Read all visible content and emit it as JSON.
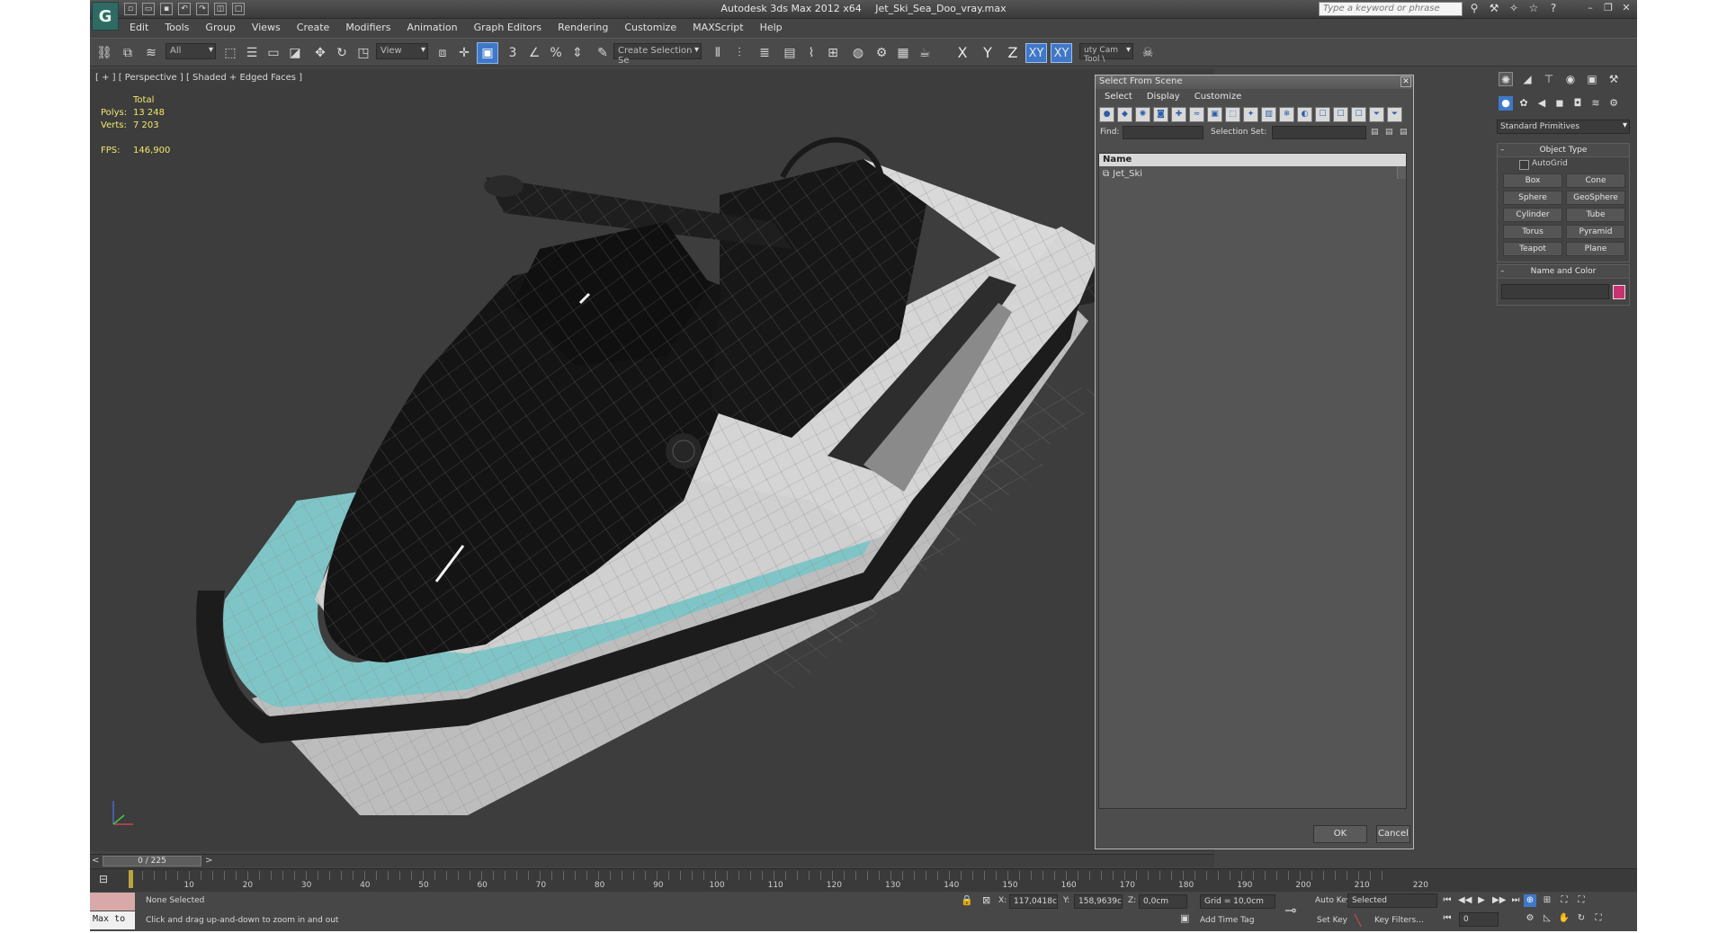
{
  "window": {
    "app_name": "Autodesk 3ds Max  2012 x64",
    "file_name": "Jet_Ski_Sea_Doo_vray.max",
    "logo_letter": "G",
    "search_placeholder": "Type a keyword or phrase"
  },
  "menu": [
    "Edit",
    "Tools",
    "Group",
    "Views",
    "Create",
    "Modifiers",
    "Animation",
    "Graph Editors",
    "Rendering",
    "Customize",
    "MAXScript",
    "Help"
  ],
  "toolbar": {
    "selection_filter": "All",
    "ref_coord": "View",
    "snap_3": "3",
    "snap_percent": "%",
    "named_selection": "Create Selection Se",
    "axis_x": "X",
    "axis_y": "Y",
    "axis_z": "Z",
    "axis_xy": "XY",
    "axis_xy2": "XY",
    "cam_tool": "uty Cam Tool \\"
  },
  "viewport": {
    "label": "[ + ] [ Perspective ] [ Shaded + Edged Faces ]",
    "stats_total": "Total",
    "polys_label": "Polys:",
    "polys_value": "13 248",
    "verts_label": "Verts:",
    "verts_value": "7 203",
    "fps_label": "FPS:",
    "fps_value": "146,900"
  },
  "dialog": {
    "title": "Select From Scene",
    "menu": [
      "Select",
      "Display",
      "Customize"
    ],
    "find_label": "Find:",
    "selection_set_label": "Selection Set:",
    "column_name": "Name",
    "items": [
      "Jet_Ski"
    ],
    "ok": "OK",
    "cancel": "Cancel"
  },
  "command_panel": {
    "category": "Standard Primitives",
    "object_type_title": "Object Type",
    "autogrid": "AutoGrid",
    "primitives": [
      "Box",
      "Cone",
      "Sphere",
      "GeoSphere",
      "Cylinder",
      "Tube",
      "Torus",
      "Pyramid",
      "Teapot",
      "Plane"
    ],
    "name_color_title": "Name and Color",
    "swatch_color": "#c8336f"
  },
  "timeline": {
    "frame_display": "0 / 225",
    "tick_labels": [
      "10",
      "20",
      "30",
      "40",
      "50",
      "60",
      "70",
      "80",
      "90",
      "100",
      "110",
      "120",
      "130",
      "140",
      "150",
      "160",
      "170",
      "180",
      "190",
      "200",
      "210",
      "220"
    ]
  },
  "status": {
    "maxscript_label": "Max to",
    "selection": "None Selected",
    "prompt": "Click and drag up-and-down to zoom in and out",
    "x_label": "X:",
    "x_value": "117,0418c",
    "y_label": "Y:",
    "y_value": "158,9639c",
    "z_label": "Z:",
    "z_value": "0,0cm",
    "grid": "Grid = 10,0cm",
    "add_time_tag": "Add Time Tag",
    "auto_key": "Auto Key",
    "auto_key_mode": "Selected",
    "set_key": "Set Key",
    "key_filters": "Key Filters...",
    "current_frame": "0"
  },
  "colors": {
    "accent": "#3f78c9",
    "hull_teal": "#7fc5c7",
    "viewport_bg": "#3d3d3d"
  }
}
